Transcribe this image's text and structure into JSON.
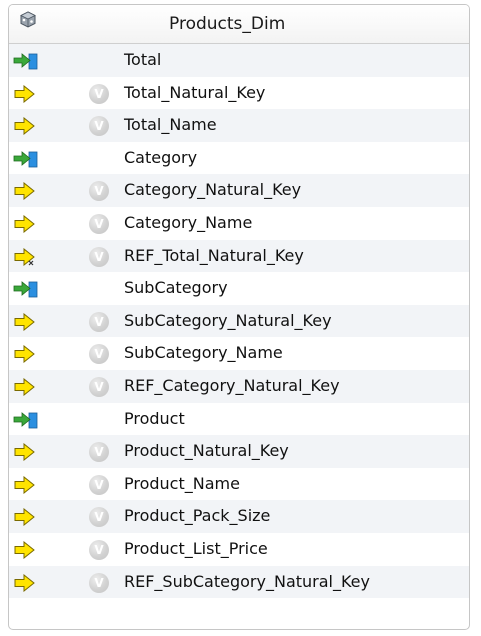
{
  "dimension": {
    "title": "Products_Dim",
    "header_icon": "dimension-cube-icon",
    "badge_letter": "V",
    "rows": [
      {
        "label": "Total",
        "type": "level"
      },
      {
        "label": "Total_Natural_Key",
        "type": "attribute"
      },
      {
        "label": "Total_Name",
        "type": "attribute"
      },
      {
        "label": "Category",
        "type": "level"
      },
      {
        "label": "Category_Natural_Key",
        "type": "attribute"
      },
      {
        "label": "Category_Name",
        "type": "attribute"
      },
      {
        "label": "REF_Total_Natural_Key",
        "type": "reference"
      },
      {
        "label": "SubCategory",
        "type": "level"
      },
      {
        "label": "SubCategory_Natural_Key",
        "type": "attribute"
      },
      {
        "label": "SubCategory_Name",
        "type": "attribute"
      },
      {
        "label": "REF_Category_Natural_Key",
        "type": "attribute"
      },
      {
        "label": "Product",
        "type": "level"
      },
      {
        "label": "Product_Natural_Key",
        "type": "attribute"
      },
      {
        "label": "Product_Name",
        "type": "attribute"
      },
      {
        "label": "Product_Pack_Size",
        "type": "attribute"
      },
      {
        "label": "Product_List_Price",
        "type": "attribute"
      },
      {
        "label": "REF_SubCategory_Natural_Key",
        "type": "attribute"
      }
    ]
  },
  "colors": {
    "level_arrow": "#3aa83a",
    "level_box": "#2b8fe0",
    "attribute_arrow": "#ffe400",
    "arrow_outline": "#7a6a00"
  }
}
